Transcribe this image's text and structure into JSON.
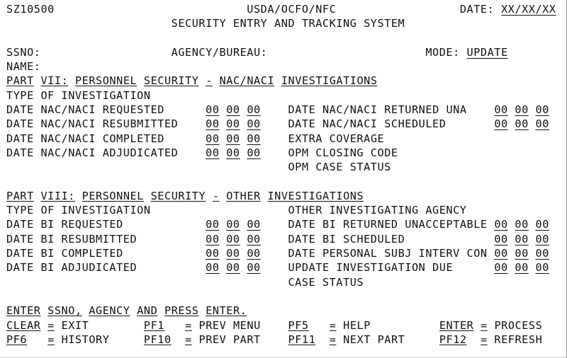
{
  "screen": {
    "id": "SZ10500",
    "org": "USDA/OCFO/NFC",
    "system_title": "SECURITY ENTRY AND TRACKING SYSTEM",
    "date_label": "DATE:",
    "date_value": "XX/XX/XX",
    "mode_label": "MODE:",
    "mode_value": "UPDATE",
    "ssno_label": "SSNO:",
    "ssno_value": "",
    "agency_label": "AGENCY/BUREAU:",
    "agency_value": "",
    "name_label": "NAME:",
    "name_value": ""
  },
  "part7": {
    "title_words": [
      "PART",
      "VII:",
      "PERSONNEL",
      "SECURITY",
      "-",
      "NAC/NACI",
      "INVESTIGATIONS"
    ],
    "left": [
      {
        "label": "TYPE OF INVESTIGATION",
        "date": null
      },
      {
        "label": "DATE NAC/NACI REQUESTED",
        "date": [
          "00",
          "00",
          "00"
        ]
      },
      {
        "label": "DATE NAC/NACI RESUBMITTED",
        "date": [
          "00",
          "00",
          "00"
        ]
      },
      {
        "label": "DATE NAC/NACI COMPLETED",
        "date": [
          "00",
          "00",
          "00"
        ]
      },
      {
        "label": "DATE NAC/NACI ADJUDICATED",
        "date": [
          "00",
          "00",
          "00"
        ]
      }
    ],
    "right": [
      {
        "label": "",
        "date": null
      },
      {
        "label": "DATE NAC/NACI RETURNED UNA",
        "date": [
          "00",
          "00",
          "00"
        ]
      },
      {
        "label": "DATE NAC/NACI SCHEDULED",
        "date": [
          "00",
          "00",
          "00"
        ]
      },
      {
        "label": "EXTRA COVERAGE",
        "date": null
      },
      {
        "label": "OPM CLOSING CODE",
        "date": null
      },
      {
        "label": "OPM CASE STATUS",
        "date": null
      }
    ]
  },
  "part8": {
    "title_words": [
      "PART",
      "VIII:",
      "PERSONNEL",
      "SECURITY",
      "-",
      "OTHER",
      "INVESTIGATIONS"
    ],
    "left": [
      {
        "label": "TYPE OF INVESTIGATION",
        "date": null
      },
      {
        "label": "DATE BI REQUESTED",
        "date": [
          "00",
          "00",
          "00"
        ]
      },
      {
        "label": "DATE BI RESUBMITTED",
        "date": [
          "00",
          "00",
          "00"
        ]
      },
      {
        "label": "DATE BI COMPLETED",
        "date": [
          "00",
          "00",
          "00"
        ]
      },
      {
        "label": "DATE BI ADJUDICATED",
        "date": [
          "00",
          "00",
          "00"
        ]
      }
    ],
    "right": [
      {
        "label": "OTHER INVESTIGATING AGENCY",
        "date": null
      },
      {
        "label": "DATE BI RETURNED UNACCEPTABLE",
        "date": [
          "00",
          "00",
          "00"
        ]
      },
      {
        "label": "DATE BI SCHEDULED",
        "date": [
          "00",
          "00",
          "00"
        ]
      },
      {
        "label": "DATE PERSONAL SUBJ INTERV CON",
        "date": [
          "00",
          "00",
          "00"
        ]
      },
      {
        "label": "UPDATE INVESTIGATION DUE",
        "date": [
          "00",
          "00",
          "00"
        ]
      },
      {
        "label": "CASE STATUS",
        "date": null
      }
    ]
  },
  "footer": {
    "prompt_words": [
      "ENTER",
      "SSNO,",
      "AGENCY",
      "AND",
      "PRESS",
      "ENTER."
    ],
    "keys": [
      {
        "key": "CLEAR",
        "eq": "=",
        "action": "EXIT"
      },
      {
        "key": "PF1",
        "eq": "=",
        "action": "PREV MENU"
      },
      {
        "key": "PF5",
        "eq": "=",
        "action": "HELP"
      },
      {
        "key": "ENTER",
        "eq": "=",
        "action": "PROCESS"
      },
      {
        "key": "PF6",
        "eq": "=",
        "action": "HISTORY"
      },
      {
        "key": "PF10",
        "eq": "=",
        "action": "PREV PART"
      },
      {
        "key": "PF11",
        "eq": "=",
        "action": "NEXT PART"
      },
      {
        "key": "PF12",
        "eq": "=",
        "action": "REFRESH"
      }
    ]
  }
}
